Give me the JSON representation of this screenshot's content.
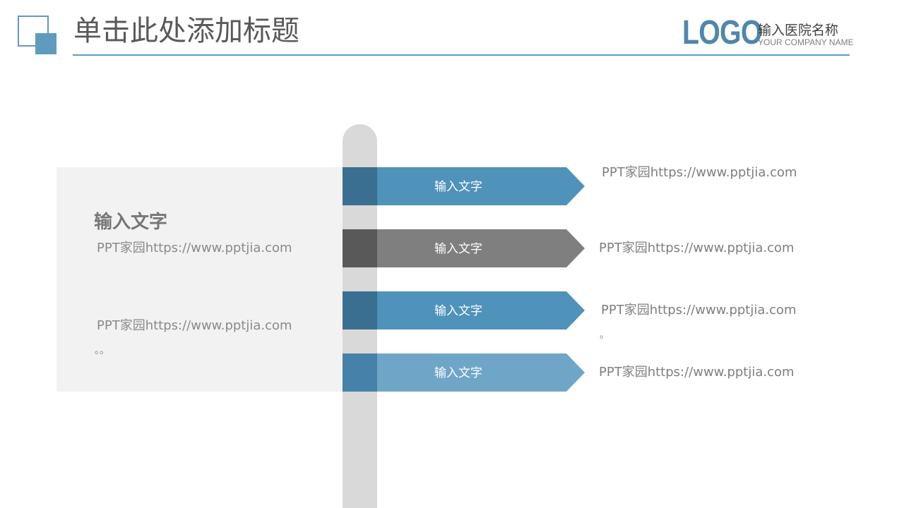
{
  "header": {
    "title": "单击此处添加标题",
    "logo": "LOGO",
    "company_cn": "输入医院名称",
    "company_en": "YOUR COMPANY NAME",
    "accent_color": "#5f9bbf"
  },
  "left_panel": {
    "heading": "输入文字",
    "text1": "PPT家园https://www.pptjia.com",
    "text2": "PPT家园https://www.pptjia.com",
    "dots": "。。"
  },
  "signs": [
    {
      "label": "输入文字",
      "text": "PPT家园https://www.pptjia.com",
      "cap_color": "#3a6f91",
      "body_color": "#4f92ba"
    },
    {
      "label": "输入文字",
      "text": "PPT家园https://www.pptjia.com",
      "cap_color": "#595959",
      "body_color": "#7f7f7f"
    },
    {
      "label": "输入文字",
      "text": "PPT家园https://www.pptjia.com",
      "extra": "。",
      "cap_color": "#3a6f91",
      "body_color": "#4f92ba"
    },
    {
      "label": "输入文字",
      "text": "PPT家园https://www.pptjia.com",
      "cap_color": "#4581a8",
      "body_color": "#6fa6c8"
    }
  ]
}
